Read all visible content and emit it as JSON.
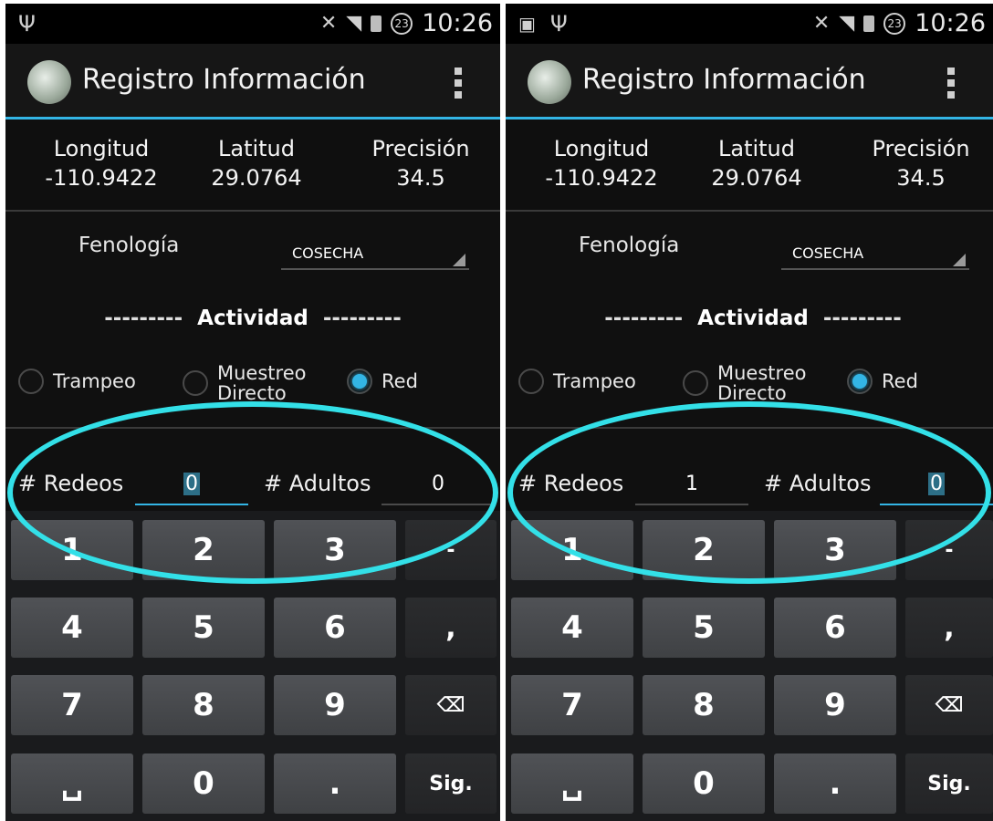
{
  "status_bar": {
    "time": "10:26",
    "notif_badge": "23"
  },
  "app_bar": {
    "title": "Registro Información"
  },
  "coords": {
    "longitud_label": "Longitud",
    "longitud_value": "-110.9422",
    "latitud_label": "Latitud",
    "latitud_value": "29.0764",
    "precision_label": "Precisión",
    "precision_value": "34.5"
  },
  "form": {
    "fenologia_label": "Fenología",
    "fenologia_value": "COSECHA",
    "actividad_dashes": "---------",
    "actividad_label": "Actividad",
    "radio_trampeo": "Trampeo",
    "radio_muestreo_1": "Muestreo",
    "radio_muestreo_2": "Directo",
    "radio_red": "Red",
    "selected_radio": "Red",
    "redeos_label": "# Redeos",
    "adultos_label": "# Adultos"
  },
  "screens": [
    {
      "redeos_value": "0",
      "adultos_value": "0",
      "focused_field": "redeos"
    },
    {
      "redeos_value": "1",
      "adultos_value": "0",
      "focused_field": "adultos"
    }
  ],
  "keyboard": {
    "k1": "1",
    "k2": "2",
    "k3": "3",
    "kminus": "-",
    "k4": "4",
    "k5": "5",
    "k6": "6",
    "kcomma": ",",
    "k7": "7",
    "k8": "8",
    "k9": "9",
    "kdel": "⌫",
    "kspace": "␣",
    "k0": "0",
    "kdot": ".",
    "knext": "Sig."
  },
  "colors": {
    "accent": "#33b5e5",
    "highlight_ring": "#33e0e8"
  }
}
